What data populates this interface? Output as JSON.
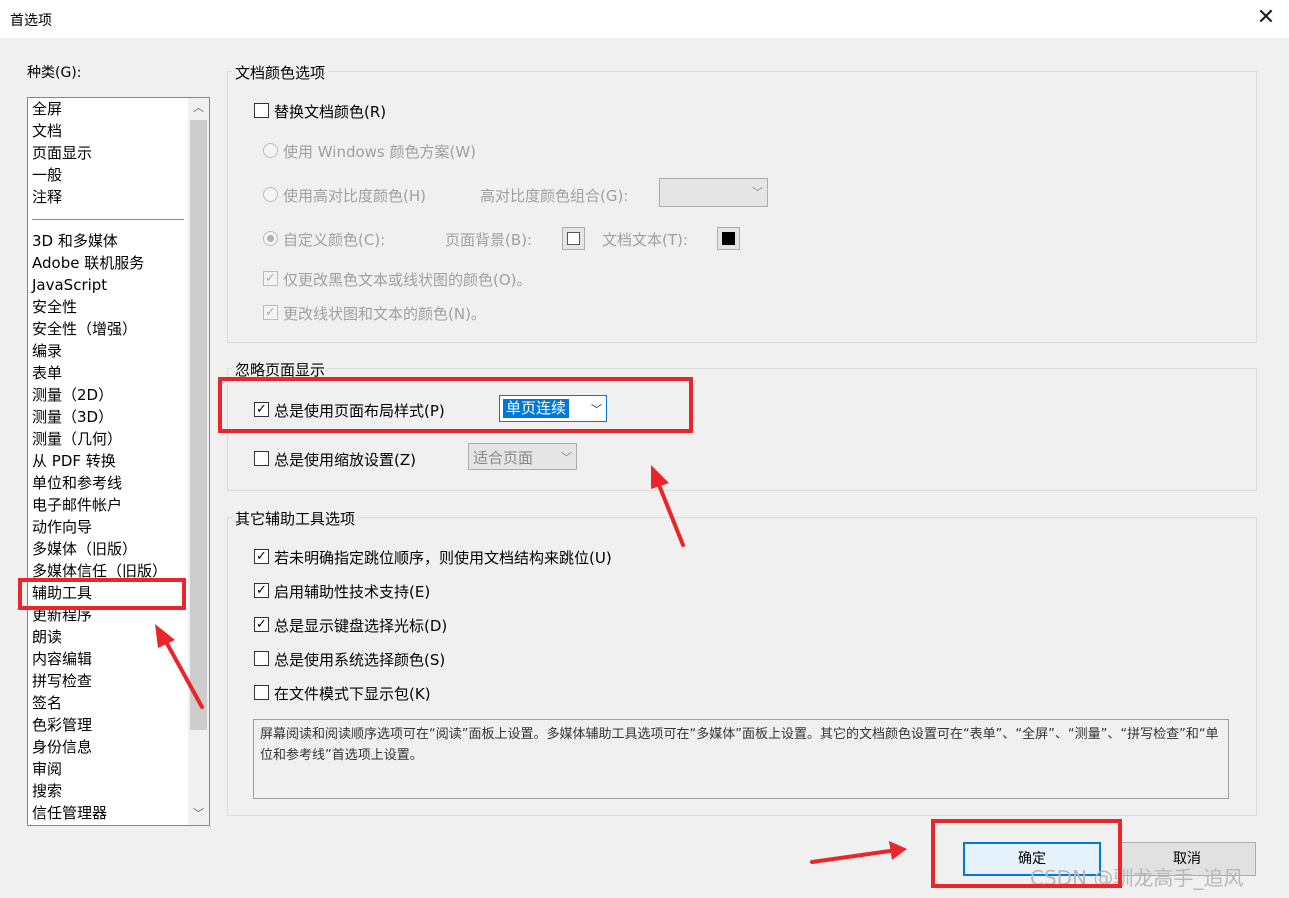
{
  "window": {
    "title": "首选项",
    "close_glyph": "✕"
  },
  "categories": {
    "label": "种类(G):",
    "items_top": [
      "全屏",
      "文档",
      "页面显示",
      "一般",
      "注释"
    ],
    "items": [
      "3D 和多媒体",
      "Adobe 联机服务",
      "JavaScript",
      "安全性",
      "安全性（增强）",
      "编录",
      "表单",
      "测量（2D）",
      "测量（3D）",
      "测量（几何）",
      "从 PDF 转换",
      "单位和参考线",
      "电子邮件帐户",
      "动作向导",
      "多媒体（旧版）",
      "多媒体信任（旧版）",
      "辅助工具",
      "更新程序",
      "朗读",
      "内容编辑",
      "拼写检查",
      "签名",
      "色彩管理",
      "身份信息",
      "审阅",
      "搜索",
      "信任管理器"
    ],
    "selected": "辅助工具"
  },
  "doc_color": {
    "title": "文档颜色选项",
    "replace_colors": {
      "label": "替换文档颜色(R)",
      "checked": false
    },
    "windows_scheme": {
      "label": "使用 Windows 颜色方案(W)"
    },
    "high_contrast": {
      "label": "使用高对比度颜色(H)",
      "combo_label": "高对比度颜色组合(G):",
      "combo_value": ""
    },
    "custom": {
      "label": "自定义颜色(C):",
      "page_bg_label": "页面背景(B):",
      "doc_text_label": "文档文本(T):",
      "page_bg_color": "#ffffff",
      "doc_text_color": "#000000"
    },
    "only_black": {
      "label": "仅更改黑色文本或线状图的颜色(O)。",
      "checked": true
    },
    "change_line": {
      "label": "更改线状图和文本的颜色(N)。",
      "checked": true
    }
  },
  "override_display": {
    "title": "忽略页面显示",
    "page_layout": {
      "label": "总是使用页面布局样式(P)",
      "checked": true,
      "value": "单页连续"
    },
    "zoom": {
      "label": "总是使用缩放设置(Z)",
      "checked": false,
      "value": "适合页面"
    }
  },
  "other_options": {
    "title": "其它辅助工具选项",
    "items": [
      {
        "label": "若未明确指定跳位顺序，则使用文档结构来跳位(U)",
        "checked": true
      },
      {
        "label": "启用辅助性技术支持(E)",
        "checked": true
      },
      {
        "label": "总是显示键盘选择光标(D)",
        "checked": true
      },
      {
        "label": "总是使用系统选择颜色(S)",
        "checked": false
      },
      {
        "label": "在文件模式下显示包(K)",
        "checked": false
      }
    ],
    "note": "屏幕阅读和阅读顺序选项可在“阅读”面板上设置。多媒体辅助工具选项可在“多媒体”面板上设置。其它的文档颜色设置可在“表单”、“全屏”、“测量”、“拼写检查”和“单位和参考线”首选项上设置。"
  },
  "buttons": {
    "ok": "确定",
    "cancel": "取消"
  },
  "watermark": "CSDN @驯龙高手_追风",
  "annotation_color": "#e8262b"
}
